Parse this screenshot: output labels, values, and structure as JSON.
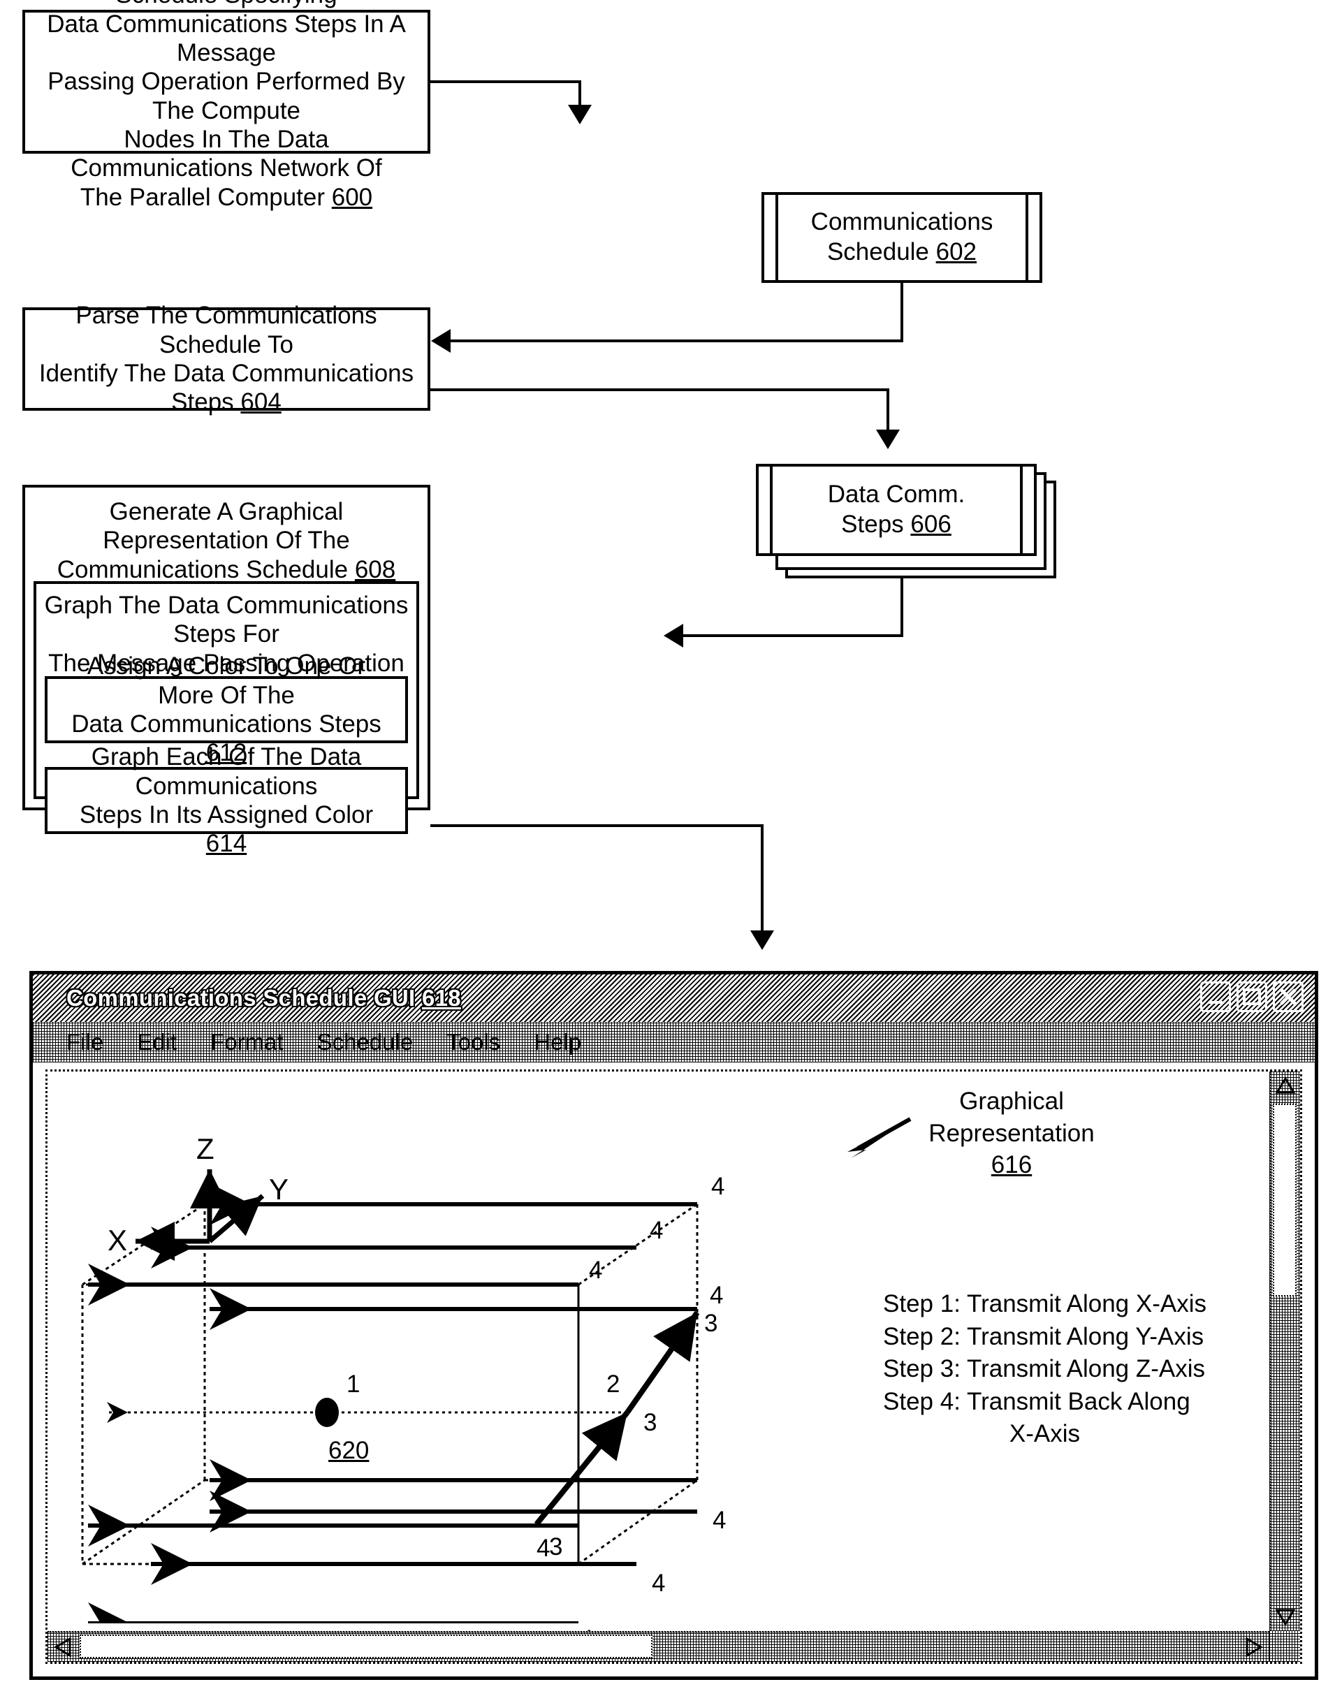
{
  "flowchart": {
    "step600": {
      "lines": [
        "Receive A Communications Schedule Specifying",
        "Data Communications Steps In A Message",
        "Passing Operation Performed By The Compute",
        "Nodes In The Data Communications Network Of",
        "The Parallel Computer "
      ],
      "ref": "600"
    },
    "schedule602": {
      "line1": "Communications",
      "line2": "Schedule ",
      "ref": "602"
    },
    "step604": {
      "lines": [
        "Parse The Communications Schedule To",
        "Identify The Data Communications Steps "
      ],
      "ref": "604"
    },
    "steps606": {
      "line1": "Data Comm.",
      "line2": "Steps ",
      "ref": "606"
    },
    "step608": {
      "lines": [
        "Generate A Graphical Representation Of The",
        "Communications Schedule "
      ],
      "ref": "608"
    },
    "step610": {
      "lines": [
        "Graph The Data Communications Steps For",
        "The Message Passing Operation "
      ],
      "ref": "610"
    },
    "step612": {
      "lines": [
        "Assign A Color To One Or More Of The",
        "Data Communications Steps "
      ],
      "ref": "612"
    },
    "step614": {
      "lines": [
        "Graph Each Of The Data Communications",
        "Steps In Its Assigned Color "
      ],
      "ref": "614"
    }
  },
  "gui": {
    "title": "Communications Schedule GUI ",
    "title_ref": "618",
    "menu": [
      "File",
      "Edit",
      "Format",
      "Schedule",
      "Tools",
      "Help"
    ],
    "window_buttons": [
      "minimize-button",
      "maximize-button",
      "close-button"
    ],
    "callout": {
      "line1": "Graphical",
      "line2": "Representation",
      "ref": "616"
    },
    "steps_legend": [
      "Step 1: Transmit Along X-Axis",
      "Step 2: Transmit Along Y-Axis",
      "Step 3: Transmit Along Z-Axis",
      "Step 4: Transmit Back Along",
      "X-Axis"
    ],
    "axes": {
      "x": "X",
      "y": "Y",
      "z": "Z"
    },
    "origin_node": {
      "step_label": "1",
      "ref": "620"
    },
    "edge_labels": {
      "step1": "1",
      "step2": "2",
      "step3": "3",
      "step4": "4"
    }
  },
  "chart_data": {
    "type": "diagram",
    "title": "Graphical Representation 616",
    "description": "3D torus mesh of compute nodes showing a 4-step message passing route",
    "axes": [
      "X",
      "Y",
      "Z"
    ],
    "origin_node_ref": "620",
    "steps": [
      {
        "id": 1,
        "label": "Step 1: Transmit Along X-Axis",
        "marker": "1"
      },
      {
        "id": 2,
        "label": "Step 2: Transmit Along Y-Axis",
        "marker": "2"
      },
      {
        "id": 3,
        "label": "Step 3: Transmit Along Z-Axis",
        "marker": "3"
      },
      {
        "id": 4,
        "label": "Step 4: Transmit Back Along X-Axis",
        "marker": "4"
      }
    ],
    "step4_edge_count": 8,
    "step3_marker_count": 3,
    "colors": {
      "stroke": "#000000",
      "background": "#ffffff"
    }
  }
}
